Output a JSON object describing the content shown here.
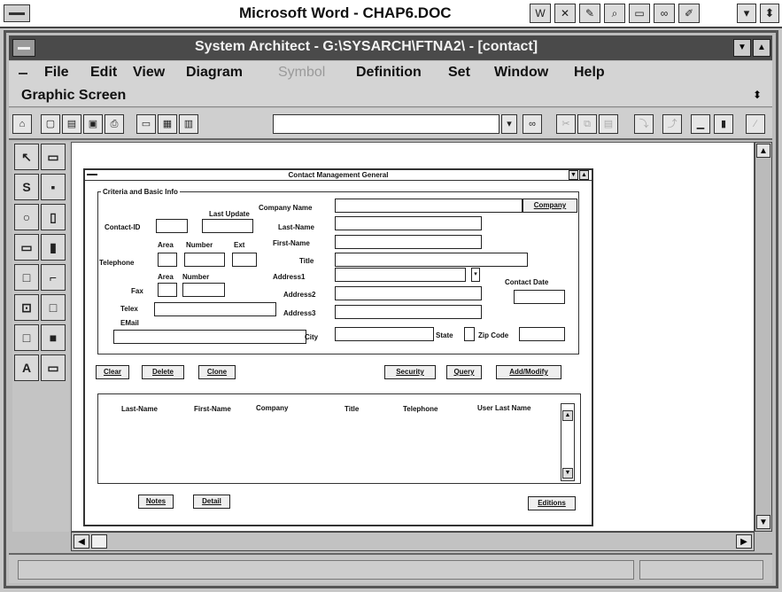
{
  "outer_window": {
    "title": "Microsoft Word - CHAP6.DOC",
    "toolbar_icons": [
      "w-icon",
      "chart-icon",
      "draw-icon",
      "zoom-icon",
      "frame-icon",
      "binoculars-icon",
      "pen-icon"
    ],
    "controls": [
      "▾",
      "⬍"
    ]
  },
  "app_window": {
    "title": "System Architect - G:\\SYSARCH\\FTNA2\\ - [contact]",
    "menu": {
      "file": "File",
      "edit": "Edit",
      "view": "View",
      "diagram": "Diagram",
      "symbol": "Symbol",
      "definition": "Definition",
      "set": "Set",
      "window": "Window",
      "help": "Help"
    },
    "second_line": "Graphic Screen",
    "toolbar": {
      "combo_value": ""
    }
  },
  "palette": {
    "tools": [
      [
        "pointer-tool-icon",
        "↖"
      ],
      [
        "rectangle-tool-icon",
        "▭"
      ],
      [
        "s-tool-icon",
        "S"
      ],
      [
        "small-box-tool-icon",
        "▪"
      ],
      [
        "radio-tool-icon",
        "○"
      ],
      [
        "list-tool-icon",
        "▯"
      ],
      [
        "edit-tool-icon",
        "▭"
      ],
      [
        "vscroll-tool-icon",
        "▮"
      ],
      [
        "frame-tool-icon",
        "□"
      ],
      [
        "shadow-box-tool-icon",
        "⌐"
      ],
      [
        "push-button-tool-icon",
        "⊡"
      ],
      [
        "square-tool-icon",
        "□"
      ],
      [
        "small-square-tool-icon",
        "□"
      ],
      [
        "filled-box-tool-icon",
        "■"
      ],
      [
        "text-tool-icon",
        "A"
      ],
      [
        "text-box-tool-icon",
        "▭"
      ]
    ]
  },
  "dialog": {
    "title": "Contact Management General",
    "group_label": "Criteria and Basic Info",
    "labels": {
      "contact_id": "Contact-ID",
      "last_update": "Last Update",
      "company_name": "Company Name",
      "last_name": "Last-Name",
      "first_name": "First-Name",
      "title": "Title",
      "area1": "Area",
      "number1": "Number",
      "ext": "Ext",
      "telephone": "Telephone",
      "area2": "Area",
      "number2": "Number",
      "fax": "Fax",
      "address1": "Address1",
      "address2": "Address2",
      "address3": "Address3",
      "contact_date": "Contact Date",
      "telex": "Telex",
      "email": "EMail",
      "city": "City",
      "state": "State",
      "zip": "Zip Code"
    },
    "buttons": {
      "company": "Company",
      "clear": "Clear",
      "delete": "Delete",
      "clone": "Clone",
      "security": "Security",
      "query": "Query",
      "add_modify": "Add/Modify",
      "notes": "Notes",
      "detail": "Detail",
      "editions": "Editions"
    },
    "list_columns": [
      "Last-Name",
      "First-Name",
      "Company",
      "Title",
      "Telephone",
      "User Last Name"
    ]
  }
}
